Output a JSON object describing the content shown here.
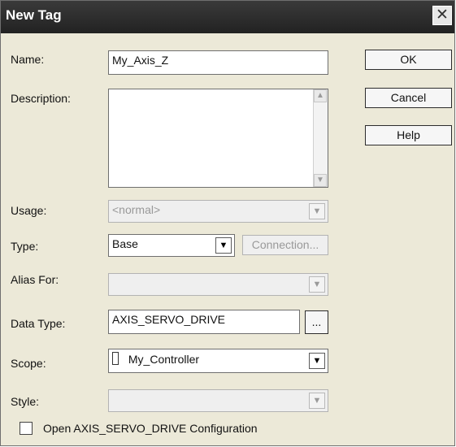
{
  "window": {
    "title": "New Tag",
    "close_glyph": "✕"
  },
  "buttons": {
    "ok": "OK",
    "cancel": "Cancel",
    "help": "Help"
  },
  "fields": {
    "name": {
      "label": "Name:",
      "value": "My_Axis_Z"
    },
    "description": {
      "label": "Description:",
      "value": ""
    },
    "usage": {
      "label": "Usage:",
      "value": "<normal>"
    },
    "type": {
      "label": "Type:",
      "value": "Base",
      "connection_button": "Connection..."
    },
    "alias_for": {
      "label": "Alias For:",
      "value": ""
    },
    "data_type": {
      "label": "Data Type:",
      "value": "AXIS_SERVO_DRIVE",
      "browse_button": "..."
    },
    "scope": {
      "label": "Scope:",
      "value": "My_Controller",
      "icon": "controller-icon"
    },
    "style": {
      "label": "Style:",
      "value": ""
    }
  },
  "options": {
    "open_config_label": "Open AXIS_SERVO_DRIVE Configuration",
    "open_config_checked": false
  },
  "icons": {
    "dropdown": "▼",
    "scroll_up": "▲",
    "scroll_down": "▼"
  }
}
